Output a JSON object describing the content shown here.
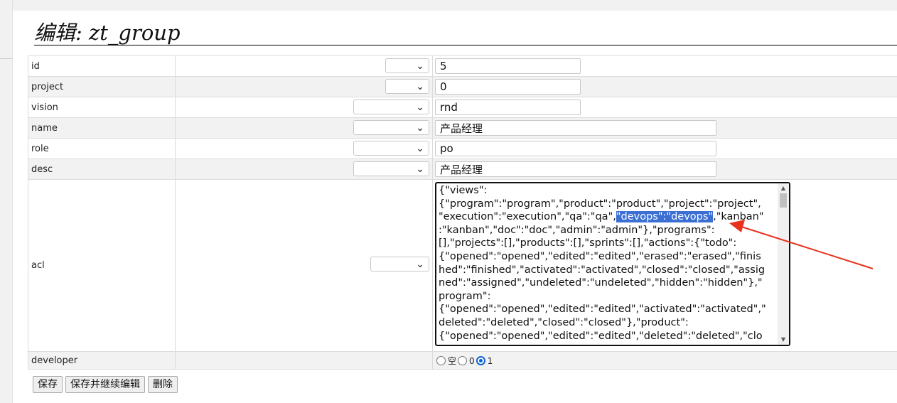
{
  "page": {
    "title": "编辑: zt_group"
  },
  "fields": [
    {
      "name": "id",
      "value": "5"
    },
    {
      "name": "project",
      "value": "0"
    },
    {
      "name": "vision",
      "value": "rnd"
    },
    {
      "name": "name",
      "value": "产品经理"
    },
    {
      "name": "role",
      "value": "po"
    },
    {
      "name": "desc",
      "value": "产品经理"
    },
    {
      "name": "acl"
    },
    {
      "name": "developer"
    }
  ],
  "acl": {
    "lines": [
      "{\"views\":",
      "{\"program\":\"program\",\"product\":\"product\",\"project\":\"project\",",
      "\"execution\":\"execution\",\"qa\":\"qa\",",
      "\"devops\":\"devops\"",
      ",\"kanban\"",
      ":\"kanban\",\"doc\":\"doc\",\"admin\":\"admin\"},\"programs\":",
      "[],\"projects\":[],\"products\":[],\"sprints\":[],\"actions\":{\"todo\":",
      "{\"opened\":\"opened\",\"edited\":\"edited\",\"erased\":\"erased\",\"finis",
      "hed\":\"finished\",\"activated\":\"activated\",\"closed\":\"closed\",\"assig",
      "ned\":\"assigned\",\"undeleted\":\"undeleted\",\"hidden\":\"hidden\"},\"",
      "program\":",
      "{\"opened\":\"opened\",\"edited\":\"edited\",\"activated\":\"activated\",\"",
      "deleted\":\"deleted\",\"closed\":\"closed\"},\"product\":",
      "{\"opened\":\"opened\",\"edited\":\"edited\",\"deleted\":\"deleted\",\"clo"
    ]
  },
  "developer": {
    "options": [
      {
        "label": "空",
        "checked": false
      },
      {
        "label": "0",
        "checked": false
      },
      {
        "label": "1",
        "checked": true
      }
    ]
  },
  "buttons": {
    "save": "保存",
    "save_continue": "保存并继续编辑",
    "delete": "删除"
  },
  "colors": {
    "highlight": "#3b6fd4",
    "arrow": "#e8321e",
    "radio_checked": "#0a64d8"
  }
}
